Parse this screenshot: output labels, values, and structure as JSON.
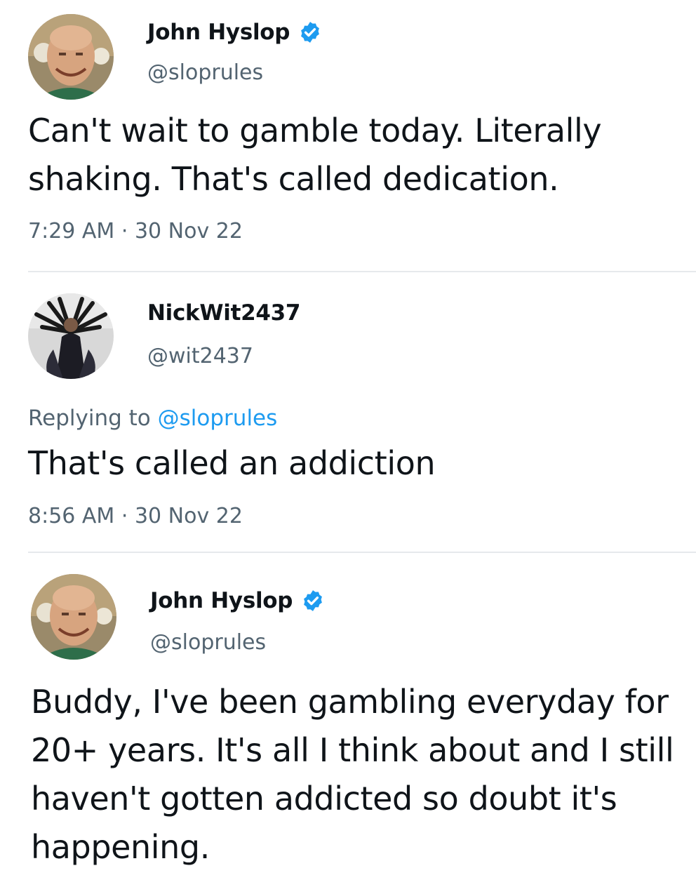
{
  "tweets": [
    {
      "author": {
        "name": "John Hyslop",
        "handle": "@sloprules",
        "verified": true,
        "avatar": "avatar-bald-man-smiling"
      },
      "text": "Can't wait to gamble today. Literally shaking. That's called dedication.",
      "time": "7:29 AM",
      "date": "30 Nov 22"
    },
    {
      "author": {
        "name": "NickWit2437",
        "handle": "@wit2437",
        "verified": false,
        "avatar": "avatar-many-armed-figure"
      },
      "replying_to_label": "Replying to",
      "replying_to_handle": "@sloprules",
      "text": "That's called an addiction",
      "time": "8:56 AM",
      "date": "30 Nov 22"
    },
    {
      "author": {
        "name": "John Hyslop",
        "handle": "@sloprules",
        "verified": true,
        "avatar": "avatar-bald-man-smiling"
      },
      "text": "Buddy, I've been gambling everyday for 20+ years. It's all I think about and I still haven't gotten addicted so doubt it's happening."
    }
  ],
  "colors": {
    "text": "#0f1419",
    "secondary": "#536471",
    "link": "#1d9bf0",
    "divider": "#e6e9ec",
    "verified": "#1d9bf0"
  },
  "separator": "·"
}
